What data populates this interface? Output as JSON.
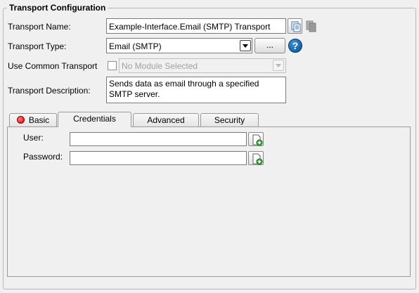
{
  "group_title": "Transport Configuration",
  "transport_name": {
    "label": "Transport Name:",
    "value": "Example-Interface.Email (SMTP) Transport",
    "icons": [
      "copy-icon",
      "copy-disabled-icon"
    ]
  },
  "transport_type": {
    "label": "Transport Type:",
    "value": "Email (SMTP)",
    "button_label": "...",
    "help_glyph": "?"
  },
  "common_transport": {
    "label": "Use Common Transport",
    "checked": false,
    "module_value": "No Module Selected"
  },
  "transport_description": {
    "label": "Transport Description:",
    "line1": "Sends data as email through a specified",
    "line2": "SMTP server."
  },
  "tabs": [
    {
      "label": "Basic",
      "active": false,
      "status_color": "#d00000"
    },
    {
      "label": "Credentials",
      "active": true
    },
    {
      "label": "Advanced",
      "active": false
    },
    {
      "label": "Security",
      "active": false
    }
  ],
  "credentials": {
    "user_label": "User:",
    "user_value": "",
    "password_label": "Password:",
    "password_value": ""
  },
  "colors": {
    "background": "#f0f0f0",
    "help_icon": "#0a4f96",
    "field_border": "#7a7a7a"
  }
}
